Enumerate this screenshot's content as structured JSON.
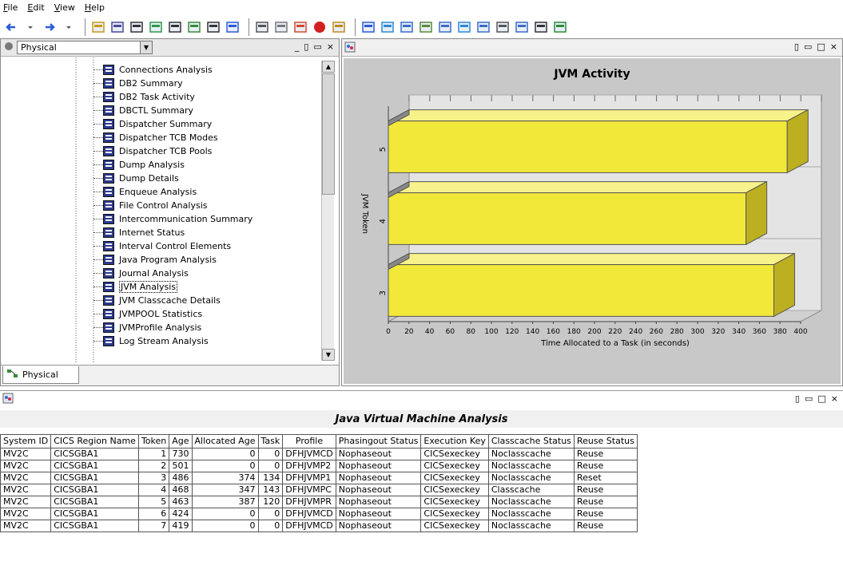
{
  "menubar": {
    "items": [
      "File",
      "Edit",
      "View",
      "Help"
    ],
    "accelerators": [
      "F",
      "E",
      "V",
      "H"
    ]
  },
  "toolbar": {
    "icons": [
      "back-arrow-icon",
      "back-dropdown-icon",
      "forward-arrow-icon",
      "forward-dropdown-icon",
      "new-folder-icon",
      "save-icon",
      "properties-icon",
      "refresh-icon",
      "tree-icon",
      "network-icon",
      "binoculars-icon",
      "help-book-icon",
      "filter-icon",
      "settings-icon",
      "palette-icon",
      "stop-icon",
      "sound-icon",
      "table-icon",
      "globe-icon",
      "bar-chart-icon",
      "line-chart-icon",
      "area-chart-icon",
      "image-icon",
      "calculator-icon",
      "document-icon",
      "pen-icon",
      "console-icon",
      "plugin-icon"
    ]
  },
  "tree_pane": {
    "view_select": "Physical",
    "window_controls": [
      "_",
      "▯",
      "▭",
      "×"
    ],
    "tab_label": "Physical",
    "items": [
      "Connections Analysis",
      "DB2 Summary",
      "DB2 Task Activity",
      "DBCTL Summary",
      "Dispatcher Summary",
      "Dispatcher TCB Modes",
      "Dispatcher TCB Pools",
      "Dump Analysis",
      "Dump Details",
      "Enqueue Analysis",
      "File Control Analysis",
      "Intercommunication Summary",
      "Internet Status",
      "Interval Control Elements",
      "Java Program Analysis",
      "Journal Analysis",
      "JVM Analysis",
      "JVM Classcache Details",
      "JVMPOOL Statistics",
      "JVMProfile Analysis",
      "Log Stream Analysis"
    ],
    "selected_item": "JVM Analysis"
  },
  "chart_pane": {
    "window_controls": [
      "▯",
      "▭",
      "□",
      "×"
    ]
  },
  "chart_data": {
    "type": "bar",
    "orientation": "horizontal",
    "title": "JVM Activity",
    "xlabel": "Time Allocated to a Task (in seconds)",
    "ylabel": "JVM Token",
    "categories": [
      "3",
      "4",
      "5"
    ],
    "values": [
      374,
      347,
      387
    ],
    "xlim": [
      0,
      400
    ],
    "xticks": [
      0,
      20,
      40,
      60,
      80,
      100,
      120,
      140,
      160,
      180,
      200,
      220,
      240,
      260,
      280,
      300,
      320,
      340,
      360,
      380,
      400
    ],
    "bar_color": "#f2e83a",
    "grid": true,
    "style": "3d"
  },
  "table_pane": {
    "title": "Java Virtual Machine Analysis",
    "window_controls": [
      "▯",
      "▭",
      "□",
      "×"
    ],
    "columns": [
      "System ID",
      "CICS Region Name",
      "Token",
      "Age",
      "Allocated Age",
      "Task",
      "Profile",
      "Phasingout Status",
      "Execution Key",
      "Classcache Status",
      "Reuse Status"
    ],
    "rows": [
      [
        "MV2C",
        "CICSGBA1",
        "1",
        "730",
        "0",
        "0",
        "DFHJVMCD",
        "Nophaseout",
        "CICSexeckey",
        "Noclasscache",
        "Reuse"
      ],
      [
        "MV2C",
        "CICSGBA1",
        "2",
        "501",
        "0",
        "0",
        "DFHJVMP2",
        "Nophaseout",
        "CICSexeckey",
        "Noclasscache",
        "Reuse"
      ],
      [
        "MV2C",
        "CICSGBA1",
        "3",
        "486",
        "374",
        "134",
        "DFHJVMP1",
        "Nophaseout",
        "CICSexeckey",
        "Noclasscache",
        "Reset"
      ],
      [
        "MV2C",
        "CICSGBA1",
        "4",
        "468",
        "347",
        "143",
        "DFHJVMPC",
        "Nophaseout",
        "CICSexeckey",
        "Classcache",
        "Reuse"
      ],
      [
        "MV2C",
        "CICSGBA1",
        "5",
        "463",
        "387",
        "120",
        "DFHJVMPR",
        "Nophaseout",
        "CICSexeckey",
        "Noclasscache",
        "Reuse"
      ],
      [
        "MV2C",
        "CICSGBA1",
        "6",
        "424",
        "0",
        "0",
        "DFHJVMCD",
        "Nophaseout",
        "CICSexeckey",
        "Noclasscache",
        "Reuse"
      ],
      [
        "MV2C",
        "CICSGBA1",
        "7",
        "419",
        "0",
        "0",
        "DFHJVMCD",
        "Nophaseout",
        "CICSexeckey",
        "Noclasscache",
        "Reuse"
      ]
    ]
  }
}
